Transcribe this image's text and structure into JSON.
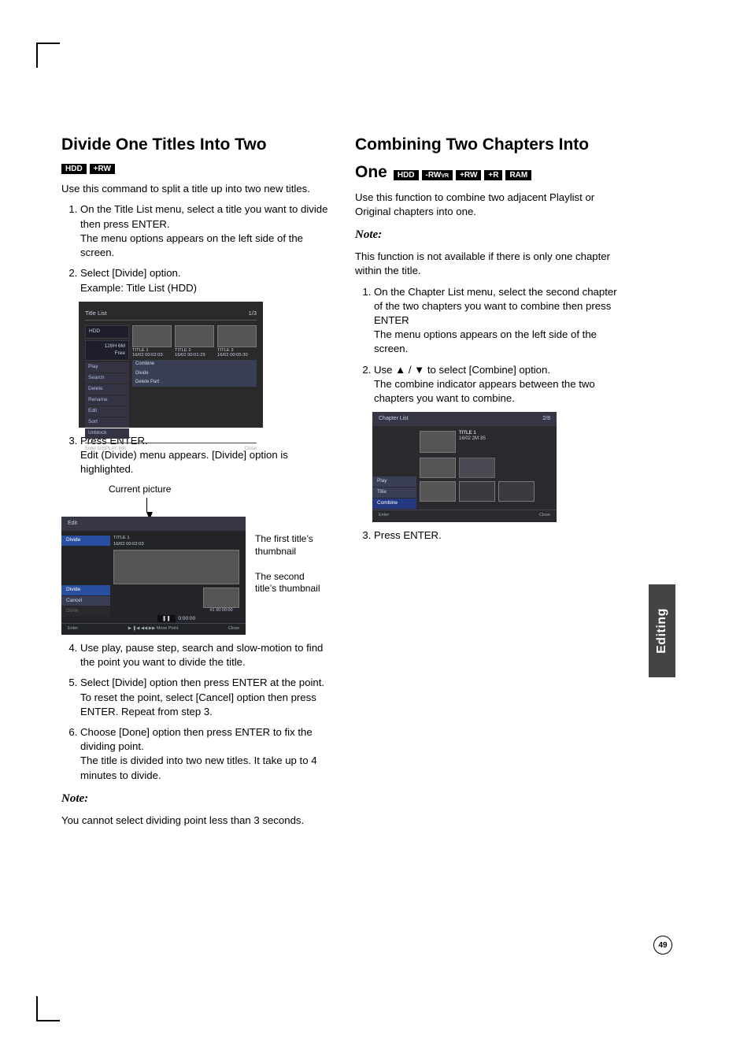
{
  "page_number": "49",
  "sidebar_tab": "Editing",
  "left": {
    "heading": "Divide One Titles Into Two",
    "badges": [
      "HDD",
      "+RW"
    ],
    "intro": "Use this command to split a title up into two new titles.",
    "steps_a": [
      {
        "t": "On the Title List menu, select a title you want to divide then press ENTER.",
        "sub": "The menu options appears on the left side of the screen."
      },
      {
        "t": "Select [Divide] option.",
        "sub": "Example: Title List (HDD)"
      }
    ],
    "shot1": {
      "title": "Title List",
      "counter": "1/3",
      "disk_label": "HDD",
      "free": "128H 6M\nFree",
      "menu": [
        "Play",
        "Search",
        "Delete",
        "Rename",
        "Edit",
        "Sort",
        "Unblock"
      ],
      "submenu": [
        "Combine",
        "Divide",
        "Delete Part"
      ],
      "thumbs": [
        {
          "n": "TITLE 1",
          "d": "16/02   00:02:03"
        },
        {
          "n": "TITLE 2",
          "d": "16/02   00:01:29"
        },
        {
          "n": "TITLE 3",
          "d": "16/02   00:05:30"
        }
      ],
      "foot_l": "Enter   DISPLAY Info",
      "foot_r": "Close"
    },
    "step3": {
      "t": "Press ENTER.",
      "sub": "Edit (Divide) menu appears. [Divide] option is highlighted."
    },
    "callout_top": "Current picture",
    "callout_r1": "The first title’s thumbnail",
    "callout_r2": "The second title’s thumbnail",
    "shot2": {
      "hdr": "Edit",
      "cap": "TITLE 1\n16/02   00:02:03",
      "btn": "Divide",
      "opts": [
        "Divide",
        "Cancel",
        "Done"
      ],
      "chip": "#1    00:00:00",
      "time": "0:00:00",
      "foot_l": "Enter",
      "foot_m": "Move Point",
      "foot_r": "Close"
    },
    "steps_b": [
      {
        "t": "Use play, pause step, search and slow-motion to find the point you want to divide the title."
      },
      {
        "t": "Select [Divide] option then press ENTER at the point.",
        "sub": "To reset the point, select [Cancel] option then press ENTER. Repeat from step 3."
      },
      {
        "t": "Choose [Done] option then press ENTER to fix the dividing point.",
        "sub": "The title is divided into two new titles. It take up to 4 minutes to divide."
      }
    ],
    "note_h": "Note:",
    "note": "You cannot select dividing point less than 3 seconds."
  },
  "right": {
    "heading": "Combining Two Chapters Into",
    "heading_trail": "One",
    "badges": [
      "HDD",
      "-RWVR",
      "+RW",
      "+R",
      "RAM"
    ],
    "intro": "Use this function to combine two adjacent Playlist or Original chapters into one.",
    "note_h": "Note:",
    "note": "This function is not available if there is only one chapter within the title.",
    "steps": [
      {
        "t": "On the Chapter List menu, select the second chapter of the two chapters you want to combine then press ENTER",
        "sub": "The menu options appears on the left side of the screen."
      },
      {
        "t": "Use ▲ / ▼ to select [Combine] option.",
        "sub": "The combine indicator appears between the two chapters you want to combine."
      }
    ],
    "shot3": {
      "hdr": "Chapter List",
      "counter": "2/8",
      "tinfo1": "TITLE 1",
      "tinfo2": "16/02   2M 3S",
      "menu": [
        "Play",
        "Title",
        "Combine"
      ],
      "foot_l": "Enter",
      "foot_r": "Close"
    },
    "step3": "Press ENTER."
  }
}
